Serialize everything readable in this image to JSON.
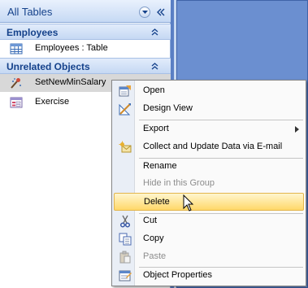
{
  "nav": {
    "title": "All Tables",
    "groups": [
      {
        "label": "Employees",
        "items": [
          {
            "label": "Employees : Table",
            "icon": "table-icon"
          }
        ]
      },
      {
        "label": "Unrelated Objects",
        "items": [
          {
            "label": "SetNewMinSalary",
            "icon": "update-query-icon"
          },
          {
            "label": "Exercise",
            "icon": "form-icon"
          }
        ]
      }
    ]
  },
  "context_menu": {
    "items": [
      {
        "label": "Open",
        "icon": "open-icon",
        "enabled": true
      },
      {
        "label": "Design View",
        "icon": "design-view-icon",
        "enabled": true
      },
      {
        "label": "Export",
        "icon": null,
        "enabled": true,
        "submenu": true
      },
      {
        "label": "Collect and Update Data via E-mail",
        "icon": "collect-data-icon",
        "enabled": true
      },
      {
        "label": "Rename",
        "icon": null,
        "enabled": true
      },
      {
        "label": "Hide in this Group",
        "icon": null,
        "enabled": false
      },
      {
        "label": "Delete",
        "icon": null,
        "enabled": true,
        "highlighted": true
      },
      {
        "label": "Cut",
        "icon": "scissors-icon",
        "enabled": true
      },
      {
        "label": "Copy",
        "icon": "copy-icon",
        "enabled": true
      },
      {
        "label": "Paste",
        "icon": "paste-icon",
        "enabled": false
      },
      {
        "label": "Object Properties",
        "icon": "properties-icon",
        "enabled": true
      }
    ]
  },
  "colors": {
    "nav_header": "#c6d9f4",
    "group_text": "#15428b",
    "highlight": "#ffd869",
    "workspace": "#6b8fd0"
  }
}
